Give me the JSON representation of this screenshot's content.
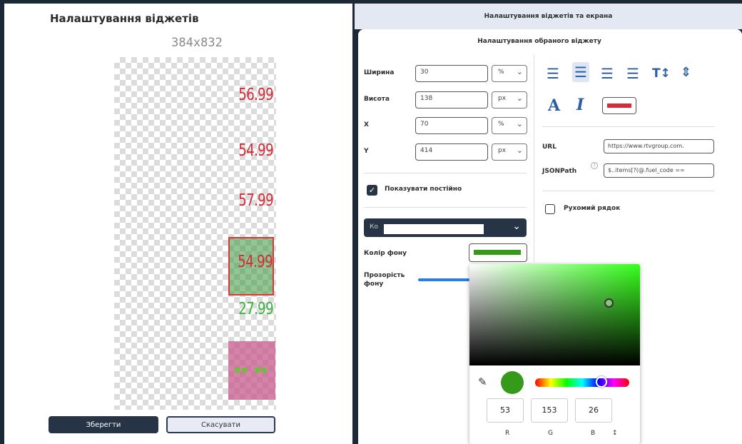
{
  "left": {
    "title": "Налаштування віджетів",
    "resolution": "384x832",
    "prices": [
      {
        "text": "56.99",
        "color": "red"
      },
      {
        "text": "54.99",
        "color": "red"
      },
      {
        "text": "57.99",
        "color": "red"
      },
      {
        "text": "27.99",
        "color": "green"
      }
    ],
    "selected_price": "54.99",
    "save_label": "Зберегти",
    "cancel_label": "Скасувати"
  },
  "right": {
    "header": "Налаштування віджетів та екрана",
    "subtitle": "Налаштування обраного віджету",
    "fields": {
      "width": {
        "label": "Ширина",
        "value": "30",
        "unit": "%"
      },
      "height": {
        "label": "Висота",
        "value": "138",
        "unit": "px"
      },
      "x": {
        "label": "X",
        "value": "70",
        "unit": "%"
      },
      "y": {
        "label": "Y",
        "value": "414",
        "unit": "px"
      }
    },
    "show_always": "Показувати постійно",
    "dropdown_value": "Ко",
    "bg_color_label": "Колір фону",
    "bg_opacity_label": "Прозорість фону",
    "url_label": "URL",
    "url_value": "https://www.rtvgroup.com.",
    "jsonpath_label": "JSONPath",
    "jsonpath_value": "$..items[?(@.fuel_code ==",
    "ticker_label": "Рухомий рядок"
  },
  "colors": {
    "bg_color": "#35991a",
    "text_color": "#d62b38",
    "accent": "#263445"
  },
  "picker": {
    "r": "53",
    "g": "153",
    "b": "26",
    "r_label": "R",
    "g_label": "G",
    "b_label": "B"
  }
}
